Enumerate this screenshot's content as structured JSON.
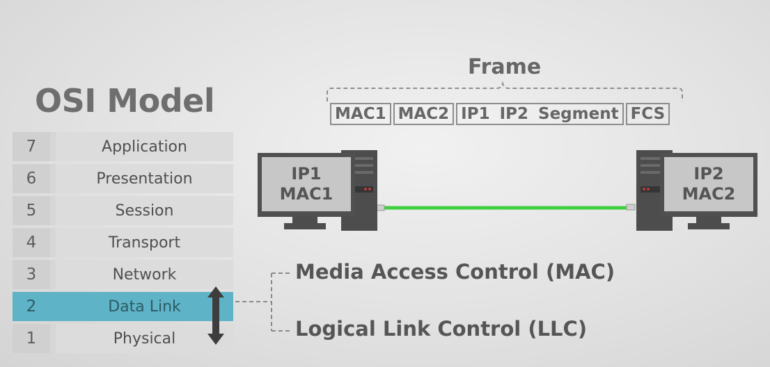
{
  "title": "OSI Model",
  "layers": [
    {
      "num": "7",
      "name": "Application"
    },
    {
      "num": "6",
      "name": "Presentation"
    },
    {
      "num": "5",
      "name": "Session"
    },
    {
      "num": "4",
      "name": "Transport"
    },
    {
      "num": "3",
      "name": "Network"
    },
    {
      "num": "2",
      "name": "Data Link"
    },
    {
      "num": "1",
      "name": "Physical"
    }
  ],
  "frame": {
    "title": "Frame",
    "cells": {
      "mac1": "MAC1",
      "mac2": "MAC2",
      "ip1": "IP1",
      "ip2": "IP2",
      "segment": "Segment",
      "fcs": "FCS"
    }
  },
  "host_left": {
    "ip": "IP1",
    "mac": "MAC1"
  },
  "host_right": {
    "ip": "IP2",
    "mac": "MAC2"
  },
  "sublayers": {
    "mac": "Media Access Control (MAC)",
    "llc": "Logical Link Control (LLC)"
  },
  "colors": {
    "highlight": "#5fb3c6",
    "cable": "#3fcf3f",
    "computer": "#4d4d4d"
  }
}
